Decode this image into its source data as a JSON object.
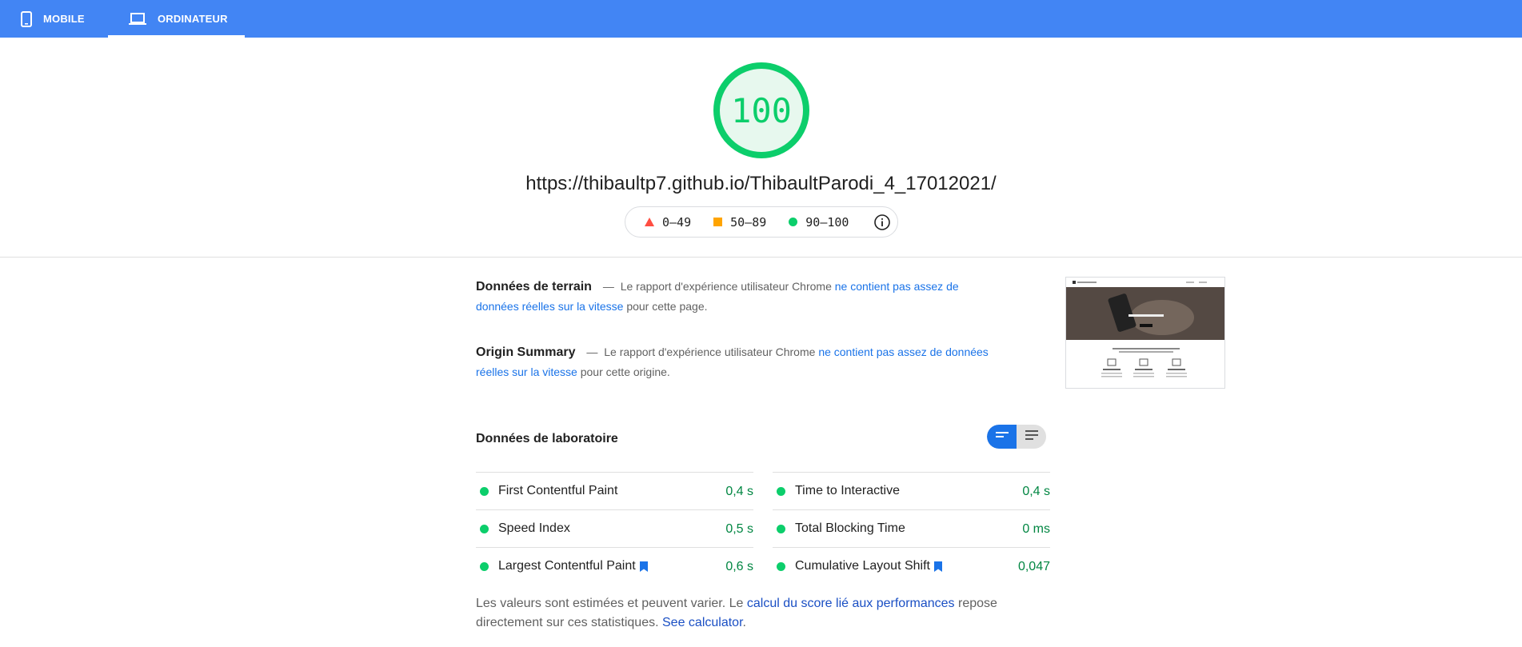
{
  "tabs": [
    {
      "label": "MOBILE",
      "icon": "smartphone-icon",
      "active": false
    },
    {
      "label": "ORDINATEUR",
      "icon": "laptop-icon",
      "active": true
    }
  ],
  "score": {
    "value": "100",
    "color": "#0cce6b",
    "fraction": 1.0
  },
  "url": "https://thibaultp7.github.io/ThibaultParodi_4_17012021/",
  "legend": [
    {
      "range": "0–49",
      "icon": "fail-triangle-icon",
      "color": "#ff4e42"
    },
    {
      "range": "50–89",
      "icon": "average-square-icon",
      "color": "#ffa400"
    },
    {
      "range": "90–100",
      "icon": "pass-circle-icon",
      "color": "#0cce6b"
    }
  ],
  "field_data": {
    "title": "Données de terrain",
    "dash": "—",
    "prefix": "Le rapport d'expérience utilisateur Chrome",
    "link": "ne contient pas assez de données réelles sur la vitesse",
    "suffix": "pour cette page."
  },
  "origin_summary": {
    "title": "Origin Summary",
    "dash": "—",
    "prefix": "Le rapport d'expérience utilisateur Chrome",
    "link": "ne contient pas assez de données réelles sur la vitesse",
    "suffix": "pour cette origine."
  },
  "lab": {
    "title": "Données de laboratoire",
    "metrics_left": [
      {
        "label": "First Contentful Paint",
        "value": "0,4 s",
        "bookmark": false
      },
      {
        "label": "Speed Index",
        "value": "0,5 s",
        "bookmark": false
      },
      {
        "label": "Largest Contentful Paint",
        "value": "0,6 s",
        "bookmark": true
      }
    ],
    "metrics_right": [
      {
        "label": "Time to Interactive",
        "value": "0,4 s",
        "bookmark": false
      },
      {
        "label": "Total Blocking Time",
        "value": "0 ms",
        "bookmark": false
      },
      {
        "label": "Cumulative Layout Shift",
        "value": "0,047",
        "bookmark": true
      }
    ]
  },
  "note": {
    "part1": "Les valeurs sont estimées et peuvent varier. Le",
    "link1": "calcul du score lié aux performances",
    "part2": "repose directement sur ces statistiques.",
    "link2": "See calculator",
    "end": "."
  },
  "colors": {
    "header": "#4285f4",
    "pass": "#0cce6b",
    "pass_text": "#018642",
    "link": "#1a73e8"
  }
}
